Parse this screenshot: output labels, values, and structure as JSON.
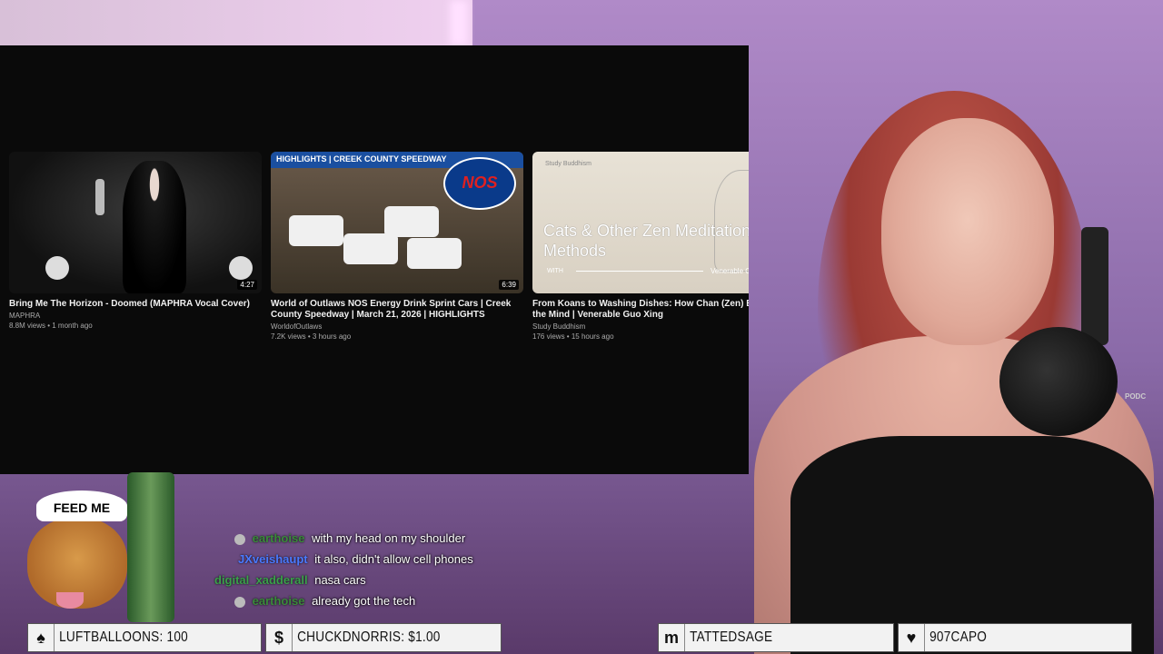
{
  "videos": [
    {
      "title": "Bring Me The Horizon - Doomed (MAPHRA Vocal Cover)",
      "channel": "MAPHRA",
      "meta": "8.8M views • 1 month ago",
      "duration": "4:27"
    },
    {
      "title": "World of Outlaws NOS Energy Drink Sprint Cars | Creek County Speedway | March 21, 2026 | HIGHLIGHTS",
      "channel": "WorldofOutlaws",
      "meta": "7.2K views • 3 hours ago",
      "duration": "6:39",
      "banner": "HIGHLIGHTS | CREEK COUNTY SPEEDWAY",
      "logo": "NOS"
    },
    {
      "title": "From Koans to Washing Dishes: How Chan (Zen) Bu Train the Mind | Venerable Guo Xing",
      "channel": "Study Buddhism",
      "meta": "176 views • 15 hours ago",
      "thumb_small": "Study Buddhism",
      "thumb_big": "Cats & Other Zen Meditation Methods",
      "thumb_with": "WITH",
      "thumb_ven": "Venerable G"
    }
  ],
  "sticker": {
    "hat_text": "FEED ME"
  },
  "chat": [
    {
      "user": "earthoise",
      "user_color": "#3a8a3a",
      "text": "with my head on my shoulder"
    },
    {
      "user": "JXveishaupt",
      "user_color": "#4a7aff",
      "text": "it also, didn't allow cell phones"
    },
    {
      "user": "digital_xadderall",
      "user_color": "#3aa04a",
      "text": "nasa cars"
    },
    {
      "user": "earthoise",
      "user_color": "#3a8a3a",
      "text": "already got the tech"
    }
  ],
  "alerts": [
    {
      "icon": "balloon-icon",
      "glyph": "♠",
      "label": "LUFTBALLOONS: 100"
    },
    {
      "icon": "dollar-icon",
      "glyph": "$",
      "label": "CHUCKDNORRIS: $1.00"
    },
    {
      "icon": "m-icon",
      "glyph": "m",
      "label": "TATTEDSAGE"
    },
    {
      "icon": "heart-icon",
      "glyph": "♥",
      "label": "907CAPO"
    }
  ],
  "mic_brand": "PODC"
}
